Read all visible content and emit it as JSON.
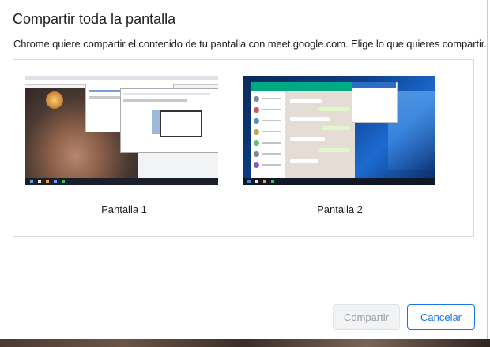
{
  "dialog": {
    "title": "Compartir toda la pantalla",
    "subtitle": "Chrome quiere compartir el contenido de tu pantalla con meet.google.com. Elige lo que quieres compartir."
  },
  "screens": [
    {
      "label": "Pantalla 1"
    },
    {
      "label": "Pantalla 2"
    }
  ],
  "buttons": {
    "share_label": "Compartir",
    "share_enabled": false,
    "cancel_label": "Cancelar"
  },
  "colors": {
    "accent": "#1a73e8",
    "disabled_text": "#9aa0a6",
    "panel_border": "#dadce0"
  }
}
